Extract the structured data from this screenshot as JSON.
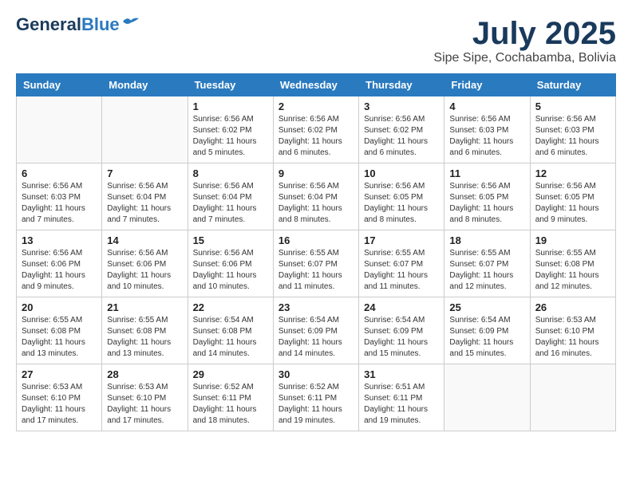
{
  "header": {
    "logo_line1": "General",
    "logo_line2": "Blue",
    "month_title": "July 2025",
    "location": "Sipe Sipe, Cochabamba, Bolivia"
  },
  "weekdays": [
    "Sunday",
    "Monday",
    "Tuesday",
    "Wednesday",
    "Thursday",
    "Friday",
    "Saturday"
  ],
  "weeks": [
    [
      {
        "day": "",
        "info": ""
      },
      {
        "day": "",
        "info": ""
      },
      {
        "day": "1",
        "info": "Sunrise: 6:56 AM\nSunset: 6:02 PM\nDaylight: 11 hours and 5 minutes."
      },
      {
        "day": "2",
        "info": "Sunrise: 6:56 AM\nSunset: 6:02 PM\nDaylight: 11 hours and 6 minutes."
      },
      {
        "day": "3",
        "info": "Sunrise: 6:56 AM\nSunset: 6:02 PM\nDaylight: 11 hours and 6 minutes."
      },
      {
        "day": "4",
        "info": "Sunrise: 6:56 AM\nSunset: 6:03 PM\nDaylight: 11 hours and 6 minutes."
      },
      {
        "day": "5",
        "info": "Sunrise: 6:56 AM\nSunset: 6:03 PM\nDaylight: 11 hours and 6 minutes."
      }
    ],
    [
      {
        "day": "6",
        "info": "Sunrise: 6:56 AM\nSunset: 6:03 PM\nDaylight: 11 hours and 7 minutes."
      },
      {
        "day": "7",
        "info": "Sunrise: 6:56 AM\nSunset: 6:04 PM\nDaylight: 11 hours and 7 minutes."
      },
      {
        "day": "8",
        "info": "Sunrise: 6:56 AM\nSunset: 6:04 PM\nDaylight: 11 hours and 7 minutes."
      },
      {
        "day": "9",
        "info": "Sunrise: 6:56 AM\nSunset: 6:04 PM\nDaylight: 11 hours and 8 minutes."
      },
      {
        "day": "10",
        "info": "Sunrise: 6:56 AM\nSunset: 6:05 PM\nDaylight: 11 hours and 8 minutes."
      },
      {
        "day": "11",
        "info": "Sunrise: 6:56 AM\nSunset: 6:05 PM\nDaylight: 11 hours and 8 minutes."
      },
      {
        "day": "12",
        "info": "Sunrise: 6:56 AM\nSunset: 6:05 PM\nDaylight: 11 hours and 9 minutes."
      }
    ],
    [
      {
        "day": "13",
        "info": "Sunrise: 6:56 AM\nSunset: 6:06 PM\nDaylight: 11 hours and 9 minutes."
      },
      {
        "day": "14",
        "info": "Sunrise: 6:56 AM\nSunset: 6:06 PM\nDaylight: 11 hours and 10 minutes."
      },
      {
        "day": "15",
        "info": "Sunrise: 6:56 AM\nSunset: 6:06 PM\nDaylight: 11 hours and 10 minutes."
      },
      {
        "day": "16",
        "info": "Sunrise: 6:55 AM\nSunset: 6:07 PM\nDaylight: 11 hours and 11 minutes."
      },
      {
        "day": "17",
        "info": "Sunrise: 6:55 AM\nSunset: 6:07 PM\nDaylight: 11 hours and 11 minutes."
      },
      {
        "day": "18",
        "info": "Sunrise: 6:55 AM\nSunset: 6:07 PM\nDaylight: 11 hours and 12 minutes."
      },
      {
        "day": "19",
        "info": "Sunrise: 6:55 AM\nSunset: 6:08 PM\nDaylight: 11 hours and 12 minutes."
      }
    ],
    [
      {
        "day": "20",
        "info": "Sunrise: 6:55 AM\nSunset: 6:08 PM\nDaylight: 11 hours and 13 minutes."
      },
      {
        "day": "21",
        "info": "Sunrise: 6:55 AM\nSunset: 6:08 PM\nDaylight: 11 hours and 13 minutes."
      },
      {
        "day": "22",
        "info": "Sunrise: 6:54 AM\nSunset: 6:08 PM\nDaylight: 11 hours and 14 minutes."
      },
      {
        "day": "23",
        "info": "Sunrise: 6:54 AM\nSunset: 6:09 PM\nDaylight: 11 hours and 14 minutes."
      },
      {
        "day": "24",
        "info": "Sunrise: 6:54 AM\nSunset: 6:09 PM\nDaylight: 11 hours and 15 minutes."
      },
      {
        "day": "25",
        "info": "Sunrise: 6:54 AM\nSunset: 6:09 PM\nDaylight: 11 hours and 15 minutes."
      },
      {
        "day": "26",
        "info": "Sunrise: 6:53 AM\nSunset: 6:10 PM\nDaylight: 11 hours and 16 minutes."
      }
    ],
    [
      {
        "day": "27",
        "info": "Sunrise: 6:53 AM\nSunset: 6:10 PM\nDaylight: 11 hours and 17 minutes."
      },
      {
        "day": "28",
        "info": "Sunrise: 6:53 AM\nSunset: 6:10 PM\nDaylight: 11 hours and 17 minutes."
      },
      {
        "day": "29",
        "info": "Sunrise: 6:52 AM\nSunset: 6:11 PM\nDaylight: 11 hours and 18 minutes."
      },
      {
        "day": "30",
        "info": "Sunrise: 6:52 AM\nSunset: 6:11 PM\nDaylight: 11 hours and 19 minutes."
      },
      {
        "day": "31",
        "info": "Sunrise: 6:51 AM\nSunset: 6:11 PM\nDaylight: 11 hours and 19 minutes."
      },
      {
        "day": "",
        "info": ""
      },
      {
        "day": "",
        "info": ""
      }
    ]
  ]
}
